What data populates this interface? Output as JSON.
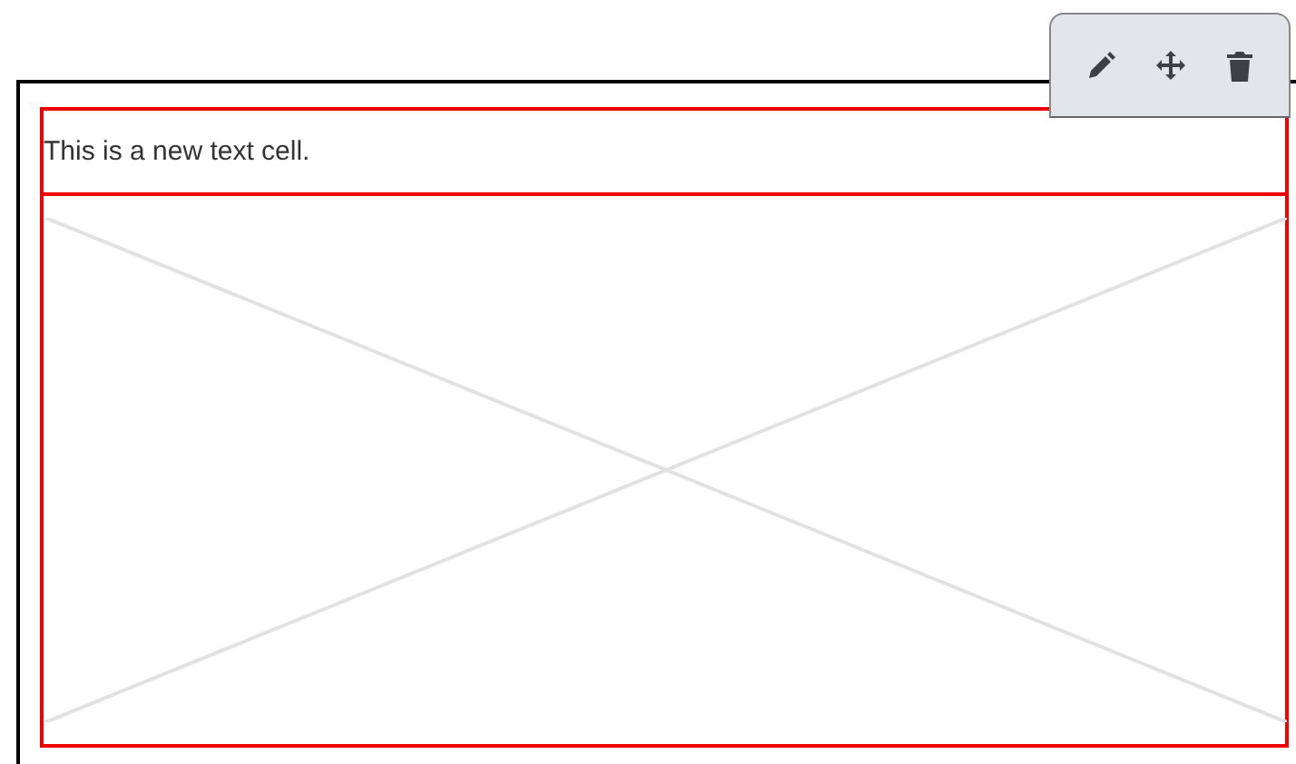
{
  "text_cell": {
    "text": "This is a new text cell."
  },
  "image_cell": {
    "kind": "placeholder"
  },
  "cell_toolbar": {
    "actions": [
      {
        "kind": "edit"
      },
      {
        "kind": "move"
      },
      {
        "kind": "delete"
      }
    ]
  }
}
